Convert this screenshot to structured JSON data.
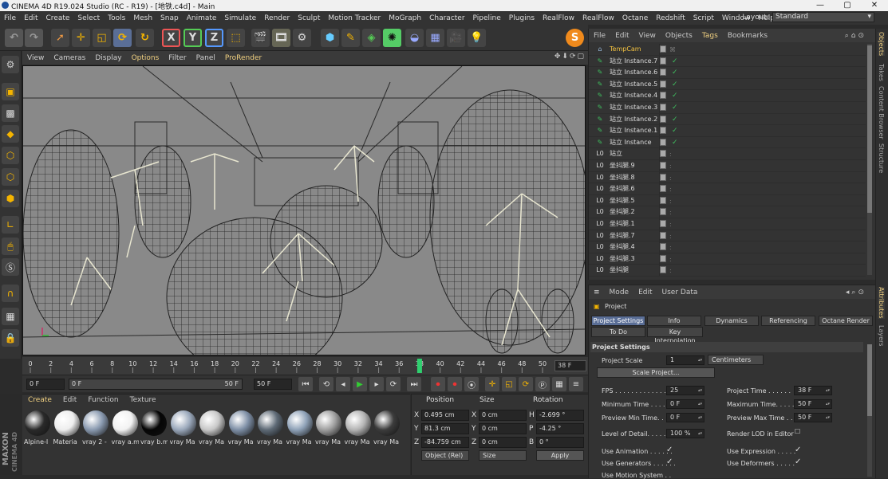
{
  "window": {
    "title": "CINEMA 4D R19.024 Studio (RC - R19) - [地铁.c4d] - Main",
    "controls": [
      "—",
      "▢",
      "✕"
    ]
  },
  "menu": {
    "items": [
      "File",
      "Edit",
      "Create",
      "Select",
      "Tools",
      "Mesh",
      "Snap",
      "Animate",
      "Simulate",
      "Render",
      "Sculpt",
      "Motion Tracker",
      "MoGraph",
      "Character",
      "Pipeline",
      "Plugins",
      "RealFlow",
      "RealFlow",
      "Octane",
      "Redshift",
      "Script",
      "Window",
      "Help"
    ],
    "layout_label": "Layout:",
    "layout_value": "Standard"
  },
  "toolbar": {
    "icons": [
      "undo-icon",
      "redo-icon",
      "live-select-icon",
      "move-icon",
      "scale-icon",
      "rotate-icon",
      "rotate-alt-icon",
      "x-axis-icon",
      "y-axis-icon",
      "z-axis-icon",
      "coordinate-system-icon",
      "render-view-icon",
      "render-picture-viewer-icon",
      "render-settings-icon",
      "cube-icon",
      "pen-icon",
      "subdivision-icon",
      "cloner-icon",
      "deformer-icon",
      "floor-icon",
      "camera-icon",
      "light-icon",
      "sketch-icon"
    ],
    "glyphs": {
      "x": "X",
      "y": "Y",
      "z": "Z",
      "s": "S"
    }
  },
  "viewport": {
    "menu": [
      "View",
      "Cameras",
      "Display",
      "Options",
      "Filter",
      "Panel",
      "ProRender"
    ],
    "active_menu": "Options",
    "nav_icons": "✥⬇⟳▢"
  },
  "timeline": {
    "ticks": [
      "0",
      "2",
      "4",
      "6",
      "8",
      "10",
      "12",
      "14",
      "16",
      "18",
      "20",
      "22",
      "24",
      "26",
      "28",
      "30",
      "32",
      "34",
      "36",
      "38",
      "40",
      "42",
      "44",
      "46",
      "48",
      "50"
    ],
    "current_frame": "38 F",
    "playhead_frame": 38,
    "max_frame": 50
  },
  "transport": {
    "start": "0 F",
    "range_start": "0 F",
    "range_end": "50 F",
    "end": "50 F"
  },
  "materials": {
    "menu": [
      "Create",
      "Edit",
      "Function",
      "Texture"
    ],
    "active_menu": "Create",
    "items": [
      {
        "label": "Alpine-I",
        "color": "#2a2a2a"
      },
      {
        "label": "Materia",
        "color": "#eeeeee"
      },
      {
        "label": "vray 2 -",
        "color": "#8a9ab0"
      },
      {
        "label": "vray a.m",
        "color": "#f2f2f2"
      },
      {
        "label": "vray b.m",
        "color": "#050505"
      },
      {
        "label": "vray Ma",
        "color": "#9aa8bb"
      },
      {
        "label": "vray Ma",
        "color": "#c8c8c8"
      },
      {
        "label": "vray Ma",
        "color": "#7e8fa6"
      },
      {
        "label": "vray Ma",
        "color": "#5e6a76"
      },
      {
        "label": "vray Ma",
        "color": "#8fa2b8"
      },
      {
        "label": "vray Ma",
        "color": "#a0a0a0"
      },
      {
        "label": "vray Ma",
        "color": "#b4b4b4"
      },
      {
        "label": "vray Ma",
        "color": "#3c3c3c"
      }
    ]
  },
  "coordinates": {
    "headers": {
      "position": "Position",
      "size": "Size",
      "rotation": "Rotation"
    },
    "rows": [
      {
        "axis": "X",
        "pos": "0.495 cm",
        "size_axis": "X",
        "size": "0 cm",
        "rot_axis": "H",
        "rot": "-2.699 °"
      },
      {
        "axis": "Y",
        "pos": "81.3 cm",
        "size_axis": "Y",
        "size": "0 cm",
        "rot_axis": "P",
        "rot": "-4.25 °"
      },
      {
        "axis": "Z",
        "pos": "-84.759 cm",
        "size_axis": "Z",
        "size": "0 cm",
        "rot_axis": "B",
        "rot": "0 °"
      }
    ],
    "mode": "Object (Rel)",
    "size_mode": "Size",
    "apply": "Apply"
  },
  "objects": {
    "menu": [
      "File",
      "Edit",
      "View",
      "Objects",
      "Tags",
      "Bookmarks"
    ],
    "active_menu": "Tags",
    "rows": [
      {
        "name": "TempCam",
        "type": "camera",
        "icon": "⌂"
      },
      {
        "name": "站立 Instance.7",
        "type": "instance",
        "icon": "✎"
      },
      {
        "name": "站立 Instance.6",
        "type": "instance",
        "icon": "✎"
      },
      {
        "name": "站立 Instance.5",
        "type": "instance",
        "icon": "✎"
      },
      {
        "name": "站立 Instance.4",
        "type": "instance",
        "icon": "✎"
      },
      {
        "name": "站立 Instance.3",
        "type": "instance",
        "icon": "✎"
      },
      {
        "name": "站立 Instance.2",
        "type": "instance",
        "icon": "✎"
      },
      {
        "name": "站立 Instance.1",
        "type": "instance",
        "icon": "✎"
      },
      {
        "name": "站立 Instance",
        "type": "instance",
        "icon": "✎"
      },
      {
        "name": "站立",
        "type": "null",
        "icon": "L0"
      },
      {
        "name": "坐抖腿.9",
        "type": "null",
        "icon": "L0"
      },
      {
        "name": "坐抖腿.8",
        "type": "null",
        "icon": "L0"
      },
      {
        "name": "坐抖腿.6",
        "type": "null",
        "icon": "L0"
      },
      {
        "name": "坐抖腿.5",
        "type": "null",
        "icon": "L0"
      },
      {
        "name": "坐抖腿.2",
        "type": "null",
        "icon": "L0"
      },
      {
        "name": "坐抖腿.1",
        "type": "null",
        "icon": "L0"
      },
      {
        "name": "坐抖腿.7",
        "type": "null",
        "icon": "L0"
      },
      {
        "name": "坐抖腿.4",
        "type": "null",
        "icon": "L0"
      },
      {
        "name": "坐抖腿.3",
        "type": "null",
        "icon": "L0"
      },
      {
        "name": "坐抖腿",
        "type": "null",
        "icon": "L0"
      }
    ],
    "right_tabs": [
      "Objects",
      "Takes",
      "Content Browser",
      "Structure"
    ]
  },
  "attributes": {
    "menu": [
      "Mode",
      "Edit",
      "User Data"
    ],
    "title": "Project",
    "tabs": [
      "Project Settings",
      "Info",
      "Dynamics",
      "Referencing",
      "Octane Render",
      "To Do",
      "Key Interpolation"
    ],
    "active_tab": "Project Settings",
    "section": "Project Settings",
    "project_scale_label": "Project Scale",
    "project_scale": "1",
    "units": "Centimeters",
    "scale_button": "Scale Project...",
    "fields_left": [
      {
        "label": "FPS . . . . . . . . . . . . .",
        "value": "25"
      },
      {
        "label": "Minimum Time . . . . .",
        "value": "0 F"
      },
      {
        "label": "Preview Min Time. . .",
        "value": "0 F"
      }
    ],
    "fields_right": [
      {
        "label": "Project Time . . . . . .",
        "value": "38 F"
      },
      {
        "label": "Maximum Time. . . . .",
        "value": "50 F"
      },
      {
        "label": "Preview Max Time . .",
        "value": "50 F"
      }
    ],
    "lod_label": "Level of Detail. . . . . .",
    "lod_value": "100 %",
    "render_lod_label": "Render LOD in Editor",
    "checks_left": [
      "Use Animation . . . . . .",
      "Use Generators . . . . . .",
      "Use Motion System . ."
    ],
    "checks_right": [
      "Use Expression . . . . .",
      "Use Deformers . . . . ."
    ],
    "right_tabs": [
      "Attributes",
      "Layers"
    ]
  }
}
